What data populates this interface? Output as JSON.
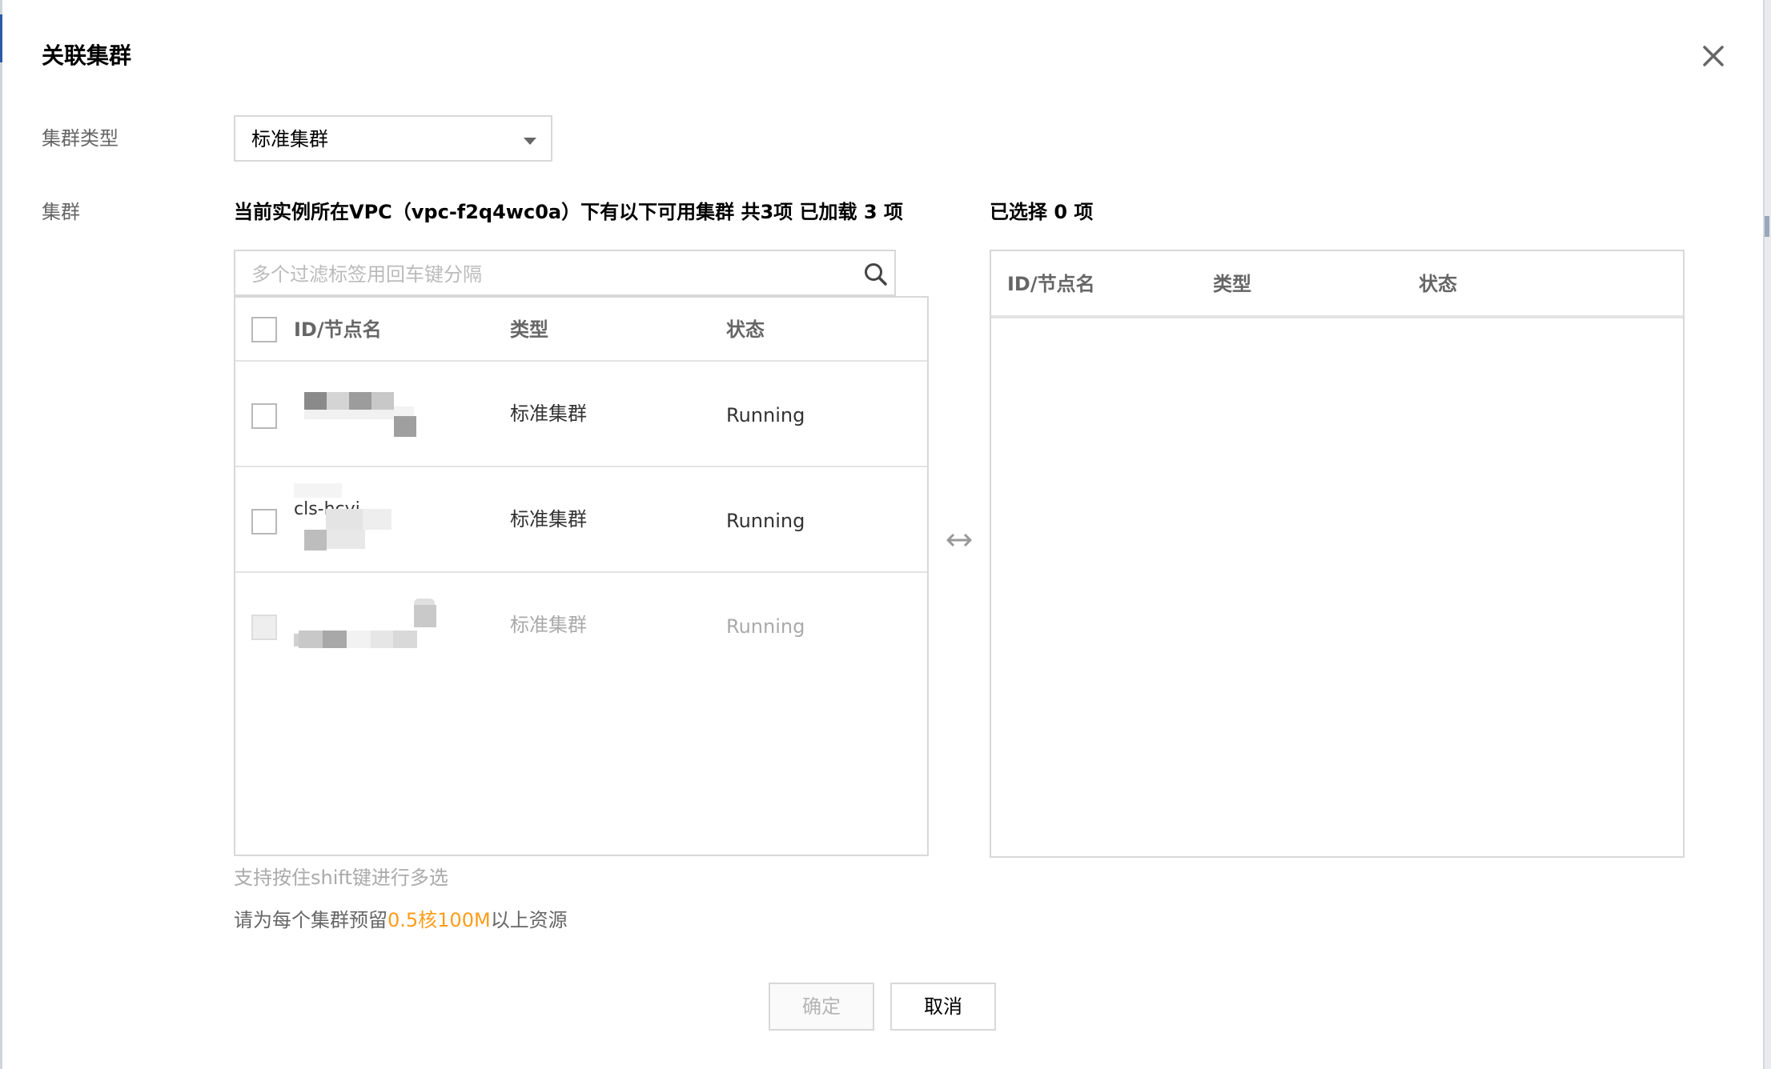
{
  "dialog": {
    "title": "关联集群"
  },
  "form": {
    "cluster_type_label": "集群类型",
    "cluster_type_value": "标准集群",
    "cluster_label": "集群"
  },
  "source": {
    "description": "当前实例所在VPC（vpc-f2q4wc0a）下有以下可用集群 共3项 已加载 3 项",
    "search_placeholder": "多个过滤标签用回车键分隔",
    "columns": [
      "ID/节点名",
      "类型",
      "状态"
    ],
    "rows": [
      {
        "id": "",
        "type": "标准集群",
        "status": "Running",
        "disabled": false
      },
      {
        "id": "cls-hcyi",
        "type": "标准集群",
        "status": "Running",
        "disabled": false
      },
      {
        "id": "",
        "type": "标准集群",
        "status": "Running",
        "disabled": true
      }
    ]
  },
  "target": {
    "title": "已选择 0 项",
    "columns": [
      "ID/节点名",
      "类型",
      "状态"
    ]
  },
  "tips": {
    "multi_select": "支持按住shift键进行多选",
    "reserve_prefix": "请为每个集群预留",
    "reserve_highlight": "0.5核100M",
    "reserve_suffix": "以上资源"
  },
  "buttons": {
    "confirm": "确定",
    "cancel": "取消"
  },
  "colors": {
    "highlight": "#ff9c19",
    "border": "#d8d8d8"
  },
  "icons": [
    "close-icon",
    "chevron-down-icon",
    "search-icon",
    "transfer-arrows-icon"
  ]
}
